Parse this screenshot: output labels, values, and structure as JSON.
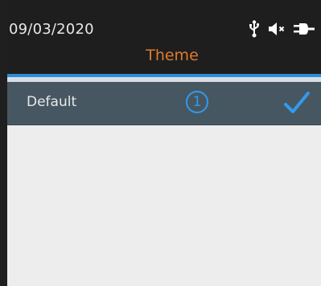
{
  "status_bar": {
    "date": "09/03/2020",
    "icons": [
      "usb-icon",
      "speaker-muted-icon",
      "power-plug-icon"
    ]
  },
  "header": {
    "title": "Theme"
  },
  "theme_list": {
    "items": [
      {
        "label": "Default",
        "number": "1",
        "selected": true
      }
    ]
  },
  "colors": {
    "header_bg": "#1e1e1e",
    "title": "#e07a2c",
    "accent": "#2f9bef",
    "selected_row_bg": "#475761",
    "content_bg": "#ededed"
  }
}
